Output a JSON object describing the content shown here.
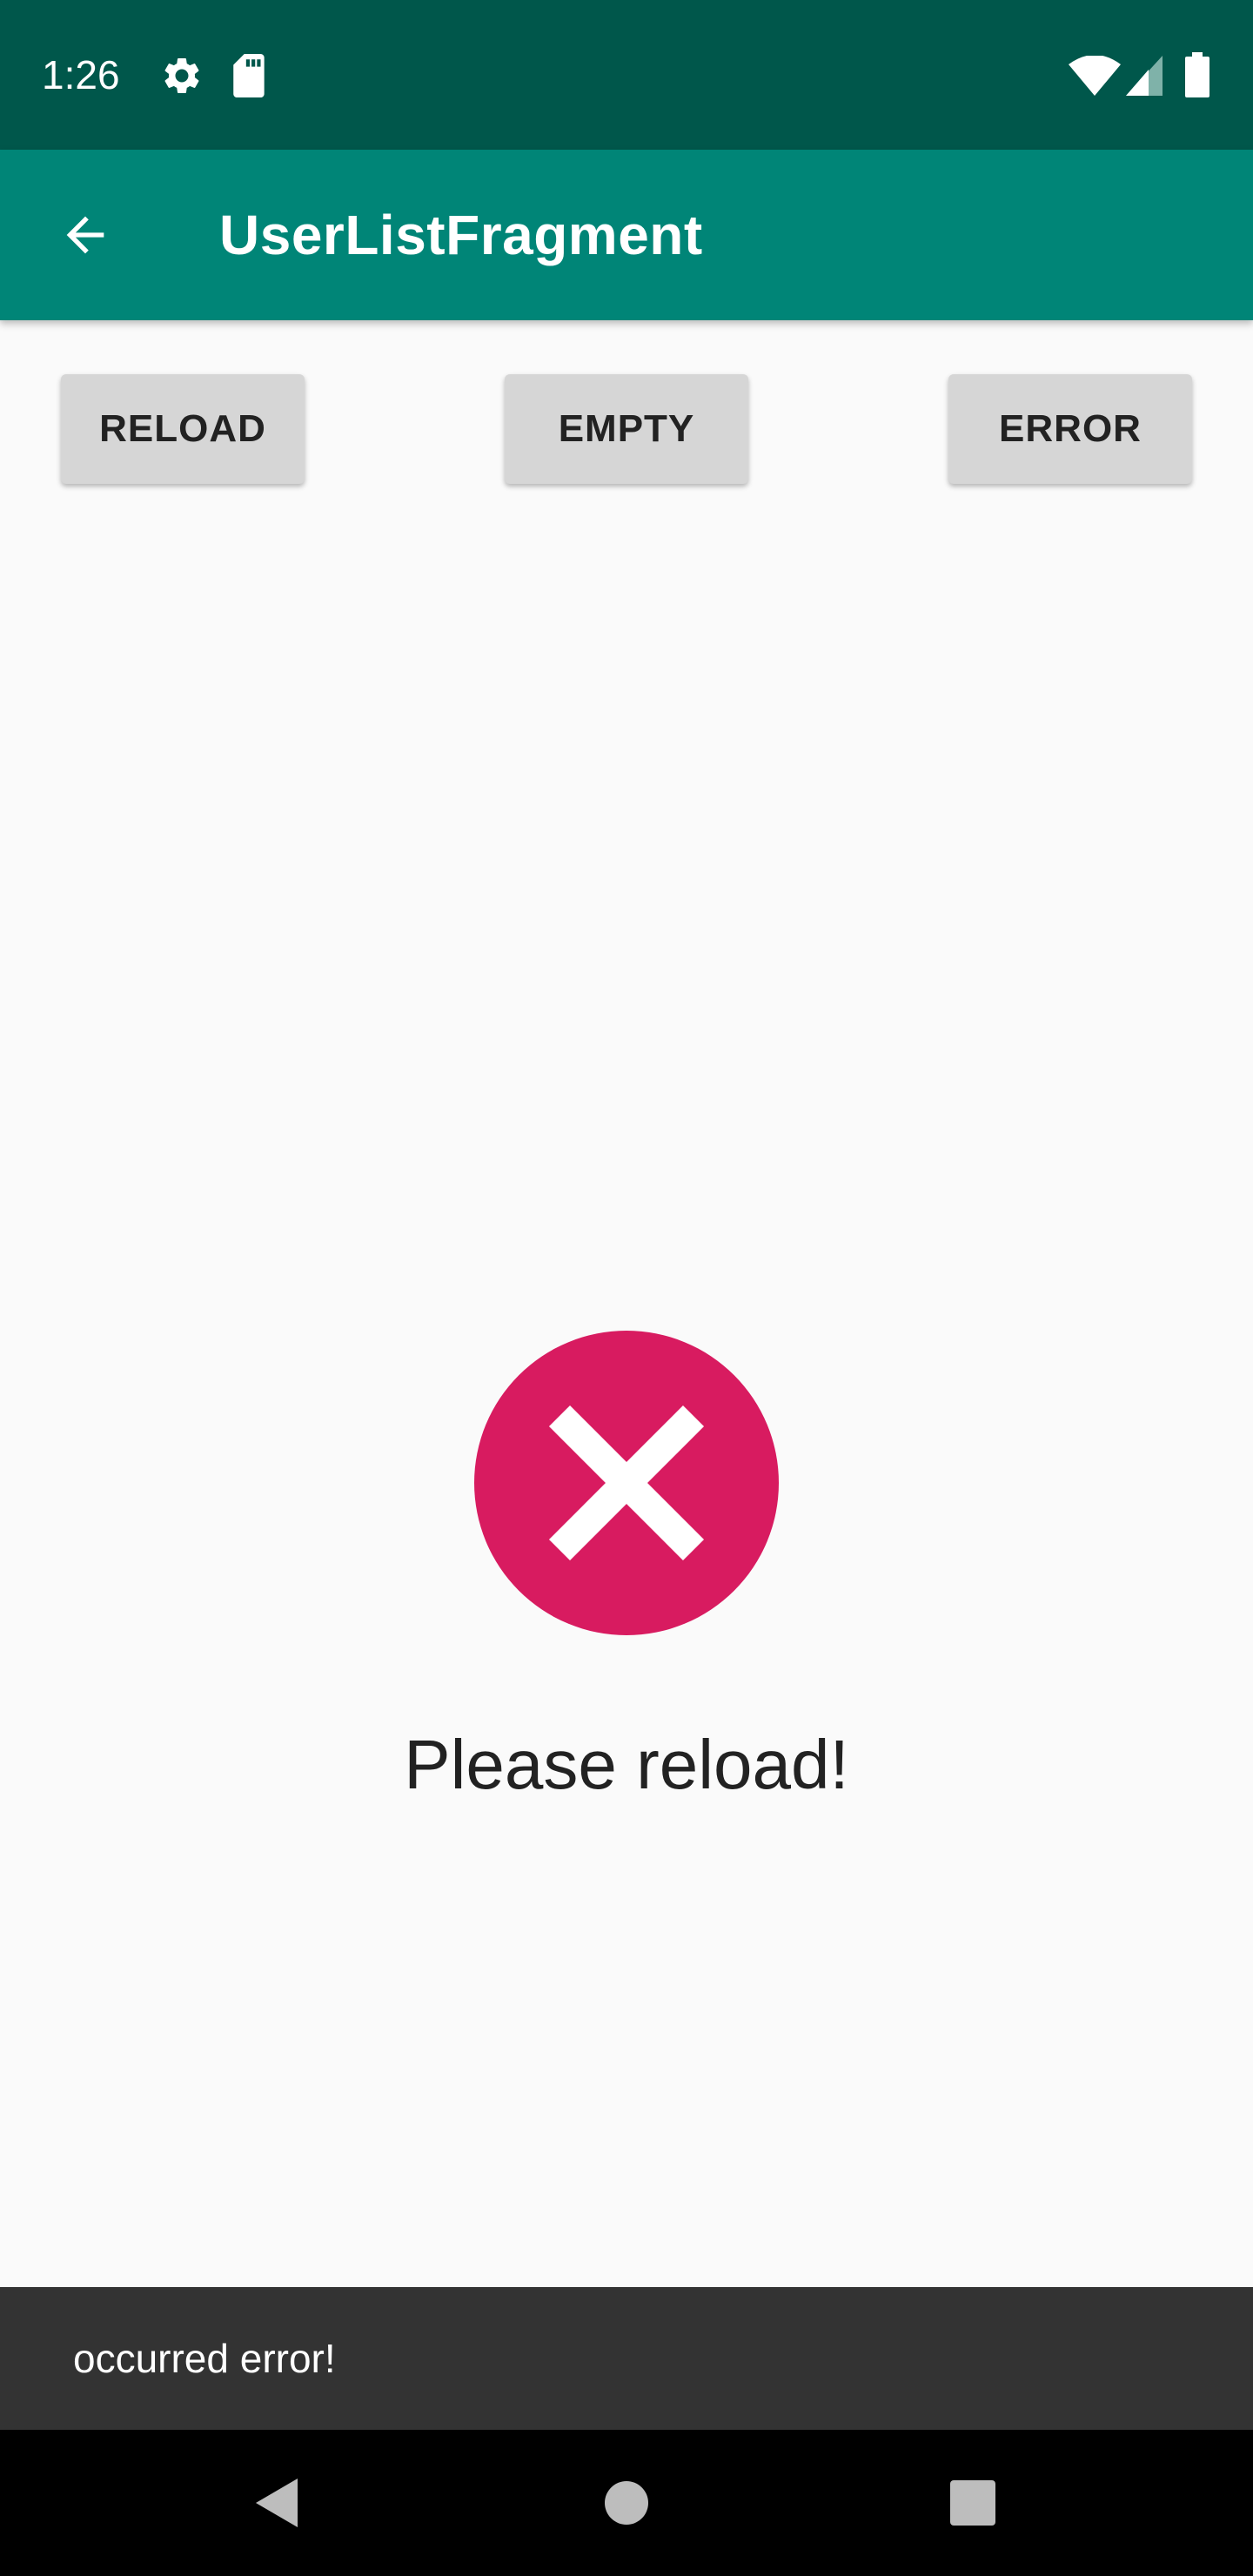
{
  "status_bar": {
    "time": "1:26",
    "icons": [
      "gear-icon",
      "sd-card-icon",
      "wifi-icon",
      "cell-signal-icon",
      "battery-icon"
    ]
  },
  "app_bar": {
    "title": "UserListFragment",
    "back_icon": "arrow-back-icon"
  },
  "buttons": {
    "reload_label": "RELOAD",
    "empty_label": "EMPTY",
    "error_label": "ERROR"
  },
  "error_state": {
    "icon": "error-x-icon",
    "message": "Please reload!"
  },
  "snackbar": {
    "text": "occurred error!"
  },
  "nav_bar": {
    "icons": [
      "back-triangle-icon",
      "home-circle-icon",
      "recents-square-icon"
    ]
  },
  "colors": {
    "status_bar": "#00574b",
    "app_bar": "#008577",
    "background": "#fafafa",
    "button": "#d6d6d6",
    "error_accent": "#d81b60",
    "snackbar": "#333333",
    "nav_bar": "#000000"
  }
}
